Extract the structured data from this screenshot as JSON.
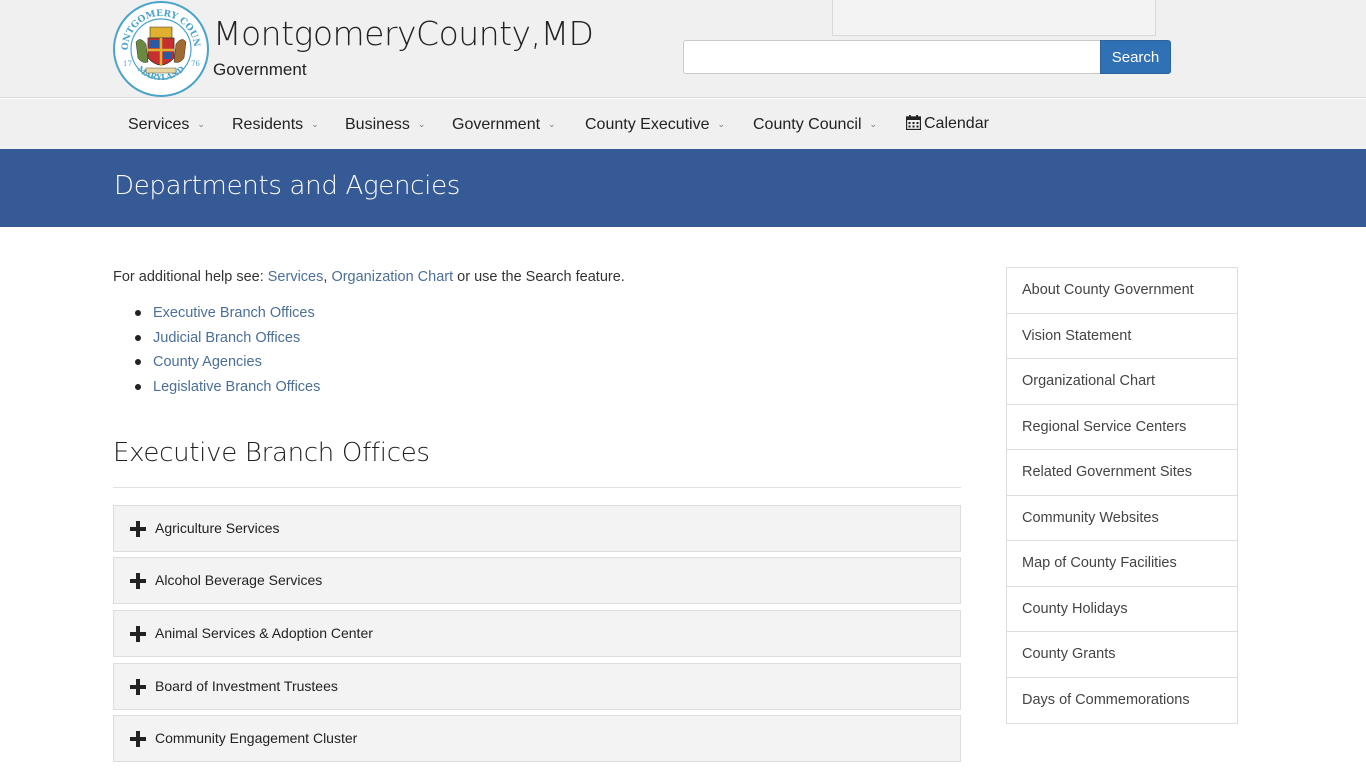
{
  "header": {
    "title": "MontgomeryCounty,MD",
    "subtitle": "Government",
    "seal": {
      "top_text": "MONTGOMERY COUNTY",
      "bottom_text": "MARYLAND",
      "year_left": "17",
      "year_right": "76"
    },
    "search": {
      "value": "",
      "placeholder": "",
      "button_label": "Search"
    }
  },
  "nav": {
    "items": [
      {
        "label": "Services",
        "has_dropdown": true
      },
      {
        "label": "Residents",
        "has_dropdown": true
      },
      {
        "label": "Business",
        "has_dropdown": true
      },
      {
        "label": "Government",
        "has_dropdown": true
      },
      {
        "label": "County Executive",
        "has_dropdown": true
      },
      {
        "label": "County Council",
        "has_dropdown": true
      }
    ],
    "calendar": {
      "label": "Calendar",
      "icon": "calendar-icon"
    }
  },
  "banner": {
    "title": "Departments and Agencies"
  },
  "main": {
    "intro": {
      "prefix": "For additional help see: ",
      "link1": "Services",
      "sep": ", ",
      "link2": "Organization Chart",
      "suffix": " or use the Search feature."
    },
    "toc": [
      "Executive Branch Offices",
      "Judicial Branch Offices",
      "County Agencies",
      "Legislative Branch Offices"
    ],
    "section_title": "Executive Branch Offices",
    "accordion": [
      "Agriculture Services",
      "Alcohol Beverage Services",
      "Animal Services & Adoption Center",
      "Board of Investment Trustees",
      "Community Engagement Cluster"
    ]
  },
  "sidebar": {
    "items": [
      "About County Government",
      "Vision Statement",
      "Organizational Chart",
      "Regional Service Centers",
      "Related Government Sites",
      "Community Websites",
      "Map of County Facilities",
      "County Holidays",
      "County Grants",
      "Days of Commemorations"
    ]
  },
  "colors": {
    "banner": "#355a96",
    "link": "#4b6f98",
    "search_button": "#2f71b4",
    "header_bg": "#f0f0f0"
  }
}
